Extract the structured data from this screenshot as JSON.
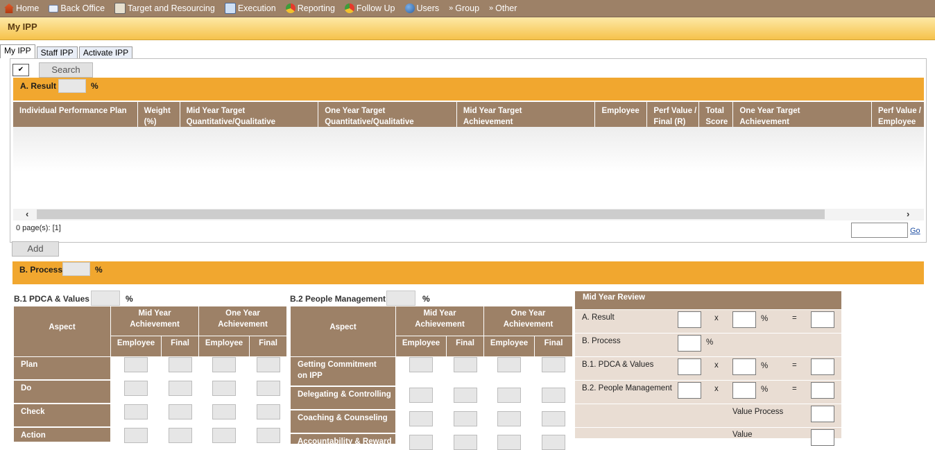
{
  "nav": {
    "items": [
      {
        "label": "Home",
        "icon": "home-icon"
      },
      {
        "label": "Back Office",
        "icon": "mail-icon"
      },
      {
        "label": "Target and Resourcing",
        "icon": "target-icon"
      },
      {
        "label": "Execution",
        "icon": "execution-icon"
      },
      {
        "label": "Reporting",
        "icon": "pie-chart-icon"
      },
      {
        "label": "Follow Up",
        "icon": "pie-chart-icon"
      },
      {
        "label": "Users",
        "icon": "users-icon"
      },
      {
        "label": "Group",
        "icon": "double-chevron-icon"
      },
      {
        "label": "Other",
        "icon": "double-chevron-icon"
      }
    ]
  },
  "page": {
    "title": "My IPP"
  },
  "tabs": [
    "My IPP",
    "Staff IPP",
    "Activate IPP"
  ],
  "search": {
    "button": "Search",
    "dropdown_icon": "chevron-down-icon"
  },
  "result": {
    "label": "A. Result",
    "pct": "%",
    "columns": [
      "Individual Performance Plan",
      "Weight\n(%)",
      "Mid Year Target\nQuantitative/Qualitative",
      "One Year Target\nQuantitative/Qualitative",
      "Mid Year Target\nAchievement",
      "Employee",
      "Perf Value /\nFinal (R)",
      "Total\nScore",
      "One Year Target\nAchievement",
      "Perf Value /\nEmployee"
    ],
    "pager": "0 page(s): [1]",
    "go": "Go",
    "add": "Add"
  },
  "process": {
    "label": "B. Process",
    "pct": "%"
  },
  "pdca": {
    "label": "B.1 PDCA & Values",
    "pct": "%",
    "aspect": "Aspect",
    "mid": "Mid Year\nAchievement",
    "one": "One Year\nAchievement",
    "employee": "Employee",
    "final": "Final",
    "rows": [
      "Plan",
      "Do",
      "Check",
      "Action"
    ]
  },
  "people": {
    "label": "B.2 People Management",
    "pct": "%",
    "aspect": "Aspect",
    "mid": "Mid Year\nAchievement",
    "one": "One Year\nAchievement",
    "employee": "Employee",
    "final": "Final",
    "rows": [
      "Getting Commitment\non IPP",
      "Delegating & Controlling",
      "Coaching & Counseling",
      "Accountability & Reward"
    ]
  },
  "review": {
    "title": "Mid Year Review",
    "result": "A. Result",
    "process": "B. Process",
    "pdca": "B.1. PDCA & Values",
    "people": "B.2. People Management",
    "x": "x",
    "pct": "%",
    "eq": "=",
    "value_process": "Value Process",
    "value": "Value"
  }
}
